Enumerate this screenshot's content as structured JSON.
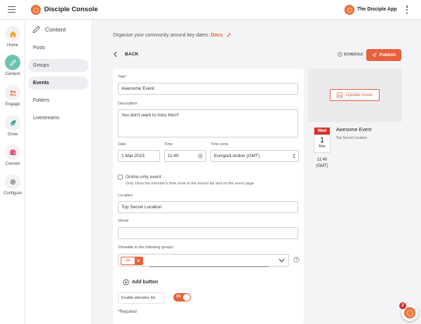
{
  "app": {
    "title": "Disciple Console",
    "app_name": "The Disciple App"
  },
  "rail": [
    {
      "label": "Home",
      "icon": "home-icon"
    },
    {
      "label": "Content",
      "icon": "pencil-icon"
    },
    {
      "label": "Engage",
      "icon": "people-icon"
    },
    {
      "label": "Grow",
      "icon": "leaf-icon"
    },
    {
      "label": "Convert",
      "icon": "wallet-icon"
    },
    {
      "label": "Configure",
      "icon": "gear-icon"
    }
  ],
  "subnav": {
    "title": "Content",
    "items": [
      "Posts",
      "Groups",
      "Events",
      "Folders",
      "Livestreams"
    ],
    "active": "Events"
  },
  "main": {
    "intro": "Organise your community around key dates.",
    "docs_link": "Docs",
    "back_label": "BACK",
    "schedule_label": "SCHEDULE",
    "publish_label": "Publish"
  },
  "form": {
    "title_label": "Title*",
    "title_value": "Awesome Event",
    "description_label": "Description",
    "description_value": "You don't want to miss this!!!",
    "date_label": "Date",
    "date_value": "1 Mar 2023",
    "time_label": "Time",
    "time_value": "11:40",
    "timezone_label": "Time zone",
    "timezone_value": "Europe/London (GMT)",
    "online_label": "Online-only event",
    "online_help": "Only show the member's time zone in the events list and on the event page",
    "location_label": "Location",
    "location_value": "Top Secret Location",
    "venue_label": "Venue",
    "venue_value": "",
    "groups_label": "Viewable to the following groups",
    "groups_chip": "All",
    "add_button": "Add button",
    "attendee_label": "Enable attendee list",
    "attendee_toggle": "On",
    "required_note": "*Required"
  },
  "preview": {
    "update_cover": "Update cover",
    "dow": "Wed",
    "day": "1",
    "month": "Mar",
    "time": "11:40",
    "tz": "(GMT)",
    "title": "Awesome Event",
    "location": "Top Secret Location"
  },
  "launcher": {
    "badge": "2"
  },
  "colors": {
    "accent": "#e8603c",
    "rail_active": "#6cc3b0",
    "date_header": "#d9302e"
  }
}
